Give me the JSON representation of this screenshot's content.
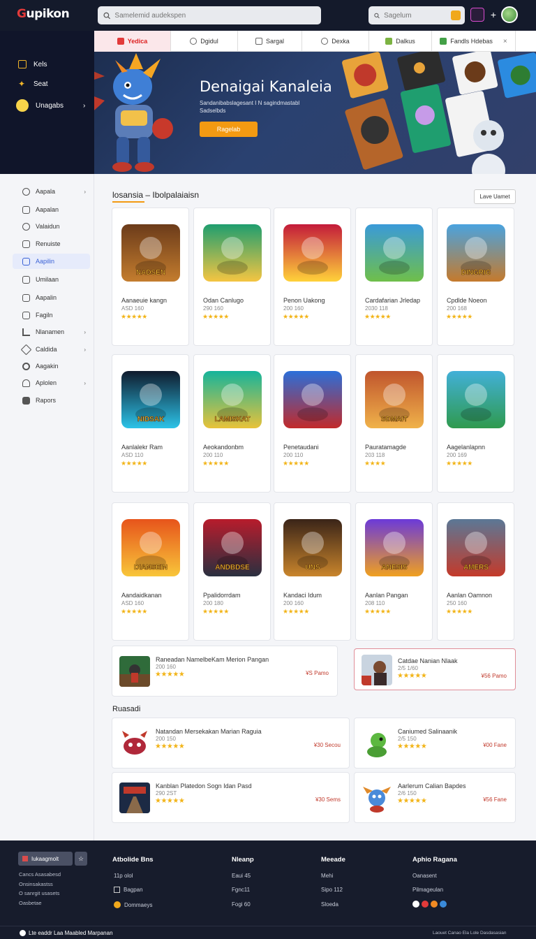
{
  "header": {
    "logo": "upikon",
    "search_placeholder": "Samelemid audekspen",
    "side_search_placeholder": "Sagelum"
  },
  "left_panel": {
    "items": [
      {
        "label": "Kels",
        "icon": "list-icon"
      },
      {
        "label": "Seat",
        "icon": "star-icon"
      },
      {
        "label": "Unagabs",
        "icon": "clock-icon"
      }
    ]
  },
  "tabs": [
    {
      "label": "Yedica",
      "icon": "fire-icon",
      "active": true
    },
    {
      "label": "Dgidul",
      "icon": "globe-icon"
    },
    {
      "label": "Sargal",
      "icon": "doc-icon"
    },
    {
      "label": "Dexka",
      "icon": "circle-icon"
    },
    {
      "label": "Dalkus",
      "icon": "grid-icon"
    },
    {
      "label": "Fandls Hdebas",
      "icon": "grid-icon"
    }
  ],
  "hero": {
    "title": "Denaigai Kanaleia",
    "subtitle": "Sandanibabslagesant I N sagindmastabl Sadselbds",
    "button": "Ragelab"
  },
  "nav": {
    "items": [
      {
        "label": "Aapala",
        "icon": "globe-icon",
        "chevron": true
      },
      {
        "label": "Aapalan",
        "icon": "window-icon"
      },
      {
        "label": "Valaidun",
        "icon": "clock-icon"
      },
      {
        "label": "Renuiste",
        "icon": "grid-icon"
      },
      {
        "label": "Aapilin",
        "icon": "image-icon",
        "active": true
      },
      {
        "label": "Umilaan",
        "icon": "window-icon"
      },
      {
        "label": "Aapalin",
        "icon": "mail-icon"
      },
      {
        "label": "Fagiln",
        "icon": "doc-icon"
      },
      {
        "label": "Nlanamen",
        "icon": "bar-icon",
        "chevron": true
      },
      {
        "label": "Caldida",
        "icon": "tag-icon",
        "chevron": true
      },
      {
        "label": "Aagakin",
        "icon": "settings-icon"
      },
      {
        "label": "Aplolen",
        "icon": "user-icon",
        "chevron": true
      },
      {
        "label": "Rapors",
        "icon": "box-icon"
      }
    ]
  },
  "main": {
    "section_title": "losansia – Ibolpalaiaisn",
    "view_all": "Lave Uamet",
    "cards": [
      {
        "name": "Aanaeuie kangn",
        "meta": "ASD 160",
        "rating": "★★★★★",
        "colors": [
          "#6b3b1a",
          "#c47d2e"
        ],
        "emblem": "NADSEN"
      },
      {
        "name": "Odan Canlugo",
        "meta": "290 160",
        "rating": "★★★★★",
        "colors": [
          "#1f9e6f",
          "#f5c542"
        ],
        "emblem": ""
      },
      {
        "name": "Penon Uakong",
        "meta": "200 160",
        "rating": "★★★★★",
        "colors": [
          "#c31b3a",
          "#ffd23a"
        ],
        "emblem": ""
      },
      {
        "name": "Cardafarian Jrledap",
        "meta": "2030 118",
        "rating": "★★★★★",
        "colors": [
          "#3a9ad9",
          "#6fbf4a"
        ],
        "emblem": ""
      },
      {
        "name": "Cpdlde Noeon",
        "meta": "200 168",
        "rating": "★★★★★",
        "colors": [
          "#4aa3df",
          "#c57a2c"
        ],
        "emblem": "DINGRIG"
      },
      {
        "name": "Aanlalekr Ram",
        "meta": "ASD 110",
        "rating": "★★★★★",
        "colors": [
          "#0f1a2c",
          "#2cc3e8"
        ],
        "emblem": "NIDSAK"
      },
      {
        "name": "Aeokandonbm",
        "meta": "200 110",
        "rating": "★★★★★",
        "colors": [
          "#16b49b",
          "#e8c23a"
        ],
        "emblem": "LAMISKAT"
      },
      {
        "name": "Penetaudani",
        "meta": "200 110",
        "rating": "★★★★★",
        "colors": [
          "#2b6fd9",
          "#c22a2a"
        ],
        "emblem": ""
      },
      {
        "name": "Pauratamagde",
        "meta": "203 118",
        "rating": "★★★★",
        "colors": [
          "#c0552d",
          "#f0b24a"
        ],
        "emblem": "SDMAIT"
      },
      {
        "name": "Aagelanlapnn",
        "meta": "200 169",
        "rating": "★★★★★",
        "colors": [
          "#42b0d8",
          "#2f9a4e"
        ],
        "emblem": ""
      },
      {
        "name": "Aandaidkanan",
        "meta": "ASD 160",
        "rating": "★★★★★",
        "colors": [
          "#e7541b",
          "#f8c63a"
        ],
        "emblem": "DIANSEIN"
      },
      {
        "name": "Ppalidorrdam",
        "meta": "200 180",
        "rating": "★★★★★",
        "colors": [
          "#b81c2c",
          "#2a3040"
        ],
        "emblem": "ANDBDSE"
      },
      {
        "name": "Kandaci Idum",
        "meta": "200 160",
        "rating": "★★★★★",
        "colors": [
          "#3a2418",
          "#c9852c"
        ],
        "emblem": "UNS"
      },
      {
        "name": "Aanlan Pangan",
        "meta": "208 110",
        "rating": "★★★★★",
        "colors": [
          "#6b3ad9",
          "#f0a020"
        ],
        "emblem": "ANESIS"
      },
      {
        "name": "Aanlan Oamnon",
        "meta": "250 160",
        "rating": "★★★★★",
        "colors": [
          "#5b7896",
          "#c43a2a"
        ],
        "emblem": "AMERS"
      }
    ],
    "featured": [
      {
        "name": "Raneadan NamelbeKam Merion Pangan",
        "meta": "200 160",
        "rating": "★★★★★",
        "price": "¥S Pamo"
      },
      {
        "name": "Catdae Nanian Nlaak",
        "meta": "2/5 1/60",
        "rating": "★★★★★",
        "price": "¥56 Pamo"
      }
    ],
    "popular_title": "Ruasadi",
    "popular": [
      {
        "name": "Natandan Mersekakan Marian Raguia",
        "meta": "200 150",
        "rating": "★★★★★",
        "price": "¥30 Secou"
      },
      {
        "name": "Caniumed Salinaanik",
        "meta": "2/5 150",
        "rating": "★★★★★",
        "price": "¥00 Fane"
      },
      {
        "name": "Kanblan Platedon Sogn Idan Pasd",
        "meta": "290 2ST",
        "rating": "★★★★★",
        "price": "¥30 Sems"
      },
      {
        "name": "Aarlerum Calian Bapdes",
        "meta": "2/6 150",
        "rating": "★★★★★",
        "price": "¥56 Fane"
      }
    ]
  },
  "footer": {
    "badge": "Iukaagmolt",
    "tagline": [
      "Cancs Asasabesd",
      "Onsinsakastss",
      "O sanrgit usasets",
      "Oasbetae"
    ],
    "columns": [
      {
        "title": "Atbolide Bns",
        "links": [
          "11p olol",
          "Bagpan",
          "Dommaeys"
        ]
      },
      {
        "title": "Nleanp",
        "links": [
          "Eaui 45",
          "Fgnc11",
          "Fogi 60"
        ]
      },
      {
        "title": "Meeade",
        "links": [
          "Mehi",
          "Sipo 112",
          "Sloeda"
        ]
      },
      {
        "title": "Aphio Ragana",
        "links": [
          "Oanasent",
          "Pilmageulan"
        ]
      }
    ],
    "bottom_left": "Lte eaddr Laa Maabled Marpanan",
    "bottom_right": "Laouet Canao Ela Lole Dasdasasian"
  }
}
